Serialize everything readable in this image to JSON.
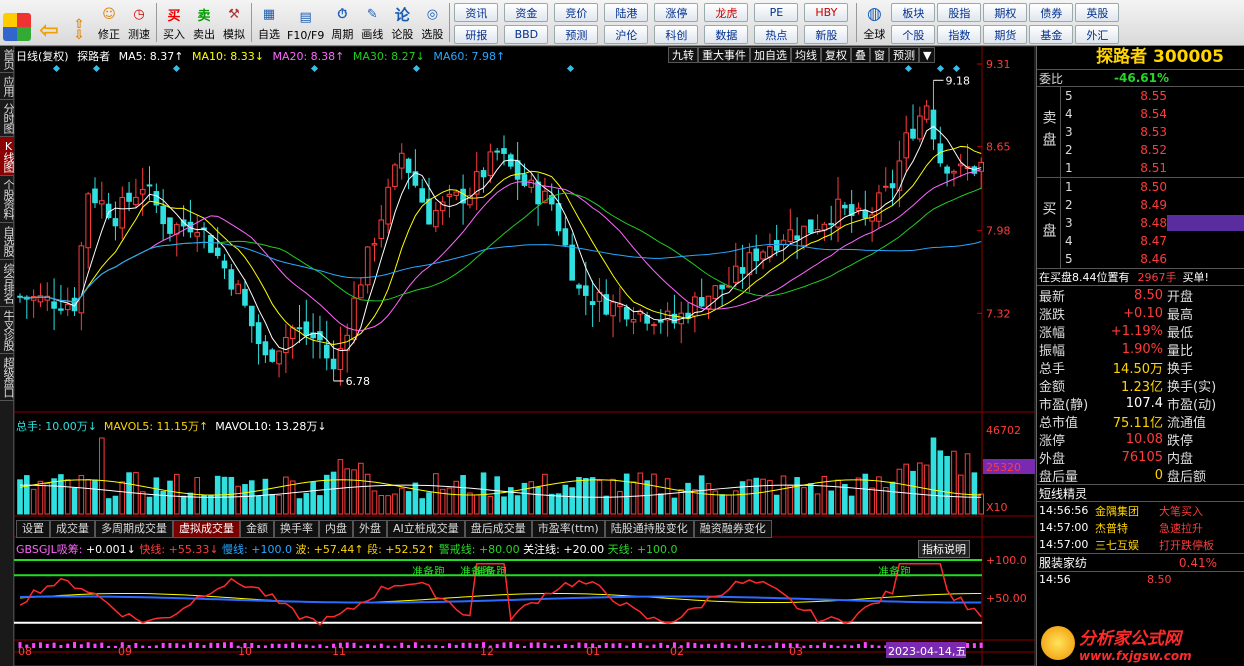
{
  "toolbar": {
    "items": [
      {
        "name": "modify",
        "label": "修正"
      },
      {
        "name": "measure",
        "label": "测速"
      },
      {
        "name": "buy",
        "label": "买入"
      },
      {
        "name": "sell",
        "label": "卖出"
      },
      {
        "name": "simulate",
        "label": "模拟"
      },
      {
        "name": "selfselect",
        "label": "自选"
      },
      {
        "name": "f10",
        "label": "F10/F9"
      },
      {
        "name": "period",
        "label": "周期"
      },
      {
        "name": "draw",
        "label": "画线"
      },
      {
        "name": "argue",
        "label": "论股"
      },
      {
        "name": "pickstock",
        "label": "选股"
      }
    ],
    "grid": [
      "资讯",
      "资金",
      "竞价",
      "陆港",
      "涨停",
      "龙虎",
      "PE",
      "",
      "研报",
      "BBD",
      "预测",
      "沪伦",
      "科创",
      "数据",
      "热点",
      "新股"
    ],
    "grid_top": [
      "资讯",
      "资金",
      "竞价",
      "陆港",
      "涨停",
      "龙虎",
      "PE",
      "HBY"
    ],
    "grid_bottom": [
      "研报",
      "BBD",
      "预测",
      "沪伦",
      "科创",
      "龙虎",
      "数据",
      "热点",
      "新股"
    ],
    "global": "全球",
    "right": [
      [
        "板块",
        "股指",
        "期权",
        "债券",
        "英股"
      ],
      [
        "个股",
        "指数",
        "期货",
        "基金",
        "外汇"
      ]
    ]
  },
  "left_tabs": [
    "首页",
    "应用",
    "分时图",
    "K线图",
    "个股资料",
    "自选股",
    "综合排名",
    "牛叉诊股",
    "超级盘口"
  ],
  "main_header": {
    "title": "日线(复权)",
    "stock": "探路者",
    "ma5": "MA5: 8.37↑",
    "ma10": "MA10: 8.33↓",
    "ma20": "MA20: 8.38↑",
    "ma30": "MA30: 8.27↓",
    "ma60": "MA60: 7.98↑"
  },
  "chart_buttons": [
    "九转",
    "重大事件",
    "加自选",
    "均线",
    "复权",
    "叠",
    "窗",
    "预测",
    "▼"
  ],
  "price_axis": [
    "9.31",
    "8.65",
    "7.98",
    "7.32"
  ],
  "high_label": "9.18",
  "low_label": "6.78",
  "vol_header": {
    "total": "总手: 10.00万↓",
    "mavol5": "MAVOL5: 11.15万↑",
    "mavol10": "MAVOL10: 13.28万↓"
  },
  "vol_axis": [
    "46702",
    "25320",
    "X10"
  ],
  "indicator_tabs": [
    "设置",
    "成交量",
    "多周期成交量",
    "虚拟成交量",
    "金额",
    "换手率",
    "内盘",
    "外盘",
    "AI立桩成交量",
    "盘后成交量",
    "市盈率(ttm)",
    "陆股通持股变化",
    "融资融券变化"
  ],
  "indicator_header": {
    "name": "GBSGJL吸筹:",
    "v1": "+0.001↓",
    "v2": "快线: +55.33↓",
    "v3": "慢线: +100.0",
    "v4": "波: +57.44↑",
    "v5": "段: +52.52↑",
    "v6": "警戒线: +80.00",
    "v7": "关注线: +20.00",
    "v8": "天线: +100.0"
  },
  "indicator_help": "指标说明",
  "ind_axis": [
    "+100.0",
    "+50.00"
  ],
  "ind_labels": [
    "准备跑",
    "准备跑",
    "准备跑",
    "准备跑"
  ],
  "date_axis": [
    "08",
    "09",
    "10",
    "11",
    "12",
    "01",
    "02",
    "03"
  ],
  "date_cursor": "2023-04-14,五",
  "right_panel": {
    "title": "探路者 300005",
    "weibi_label": "委比",
    "weibi": "-46.61%",
    "sell_label": "卖盘",
    "buy_label": "买盘",
    "sell": [
      {
        "lv": "5",
        "p": "8.55"
      },
      {
        "lv": "4",
        "p": "8.54"
      },
      {
        "lv": "3",
        "p": "8.53"
      },
      {
        "lv": "2",
        "p": "8.52"
      },
      {
        "lv": "1",
        "p": "8.51"
      }
    ],
    "buy": [
      {
        "lv": "1",
        "p": "8.50"
      },
      {
        "lv": "2",
        "p": "8.49"
      },
      {
        "lv": "3",
        "p": "8.48"
      },
      {
        "lv": "4",
        "p": "8.47"
      },
      {
        "lv": "5",
        "p": "8.46"
      }
    ],
    "notice": "在买盘8.44位置有",
    "notice_vol": "2967手",
    "notice_tag": "买单!",
    "quotes": [
      {
        "k": "最新",
        "v": "8.50",
        "c": "red",
        "k2": "开盘"
      },
      {
        "k": "涨跌",
        "v": "+0.10",
        "c": "red",
        "k2": "最高"
      },
      {
        "k": "涨幅",
        "v": "+1.19%",
        "c": "red",
        "k2": "最低"
      },
      {
        "k": "振幅",
        "v": "1.90%",
        "c": "red",
        "k2": "量比"
      },
      {
        "k": "总手",
        "v": "14.50万",
        "c": "yel",
        "k2": "换手"
      },
      {
        "k": "金额",
        "v": "1.23亿",
        "c": "yel",
        "k2": "换手(实)"
      },
      {
        "k": "市盈(静)",
        "v": "107.4",
        "c": "wht",
        "k2": "市盈(动)"
      },
      {
        "k": "总市值",
        "v": "75.11亿",
        "c": "yel",
        "k2": "流通值"
      },
      {
        "k": "涨停",
        "v": "10.08",
        "c": "red",
        "k2": "跌停"
      },
      {
        "k": "外盘",
        "v": "76105",
        "c": "red",
        "k2": "内盘"
      },
      {
        "k": "盘后量",
        "v": "0",
        "c": "yel",
        "k2": "盘后额"
      }
    ],
    "shortline_title": "短线精灵",
    "shortline": [
      {
        "t": "14:56:56",
        "n": "金隅集团",
        "e": "大笔买入"
      },
      {
        "t": "14:57:00",
        "n": "杰普特",
        "e": "急速拉升"
      },
      {
        "t": "14:57:00",
        "n": "三七互娱",
        "e": "打开跌停板"
      }
    ],
    "sector_name": "服装家纺",
    "sector_pct": "0.41%",
    "tick_time": "14:56",
    "tick_price": "8.50",
    "watermark": "分析家公式网",
    "watermark_url": "www.fxjgsw.com"
  },
  "colors": {
    "up": "#ff3c3c",
    "down": "#30e0e0",
    "ma5": "#ffffff",
    "ma10": "#ffff00",
    "ma20": "#ff66ff",
    "ma30": "#22cc22",
    "ma60": "#2aa8ff"
  }
}
